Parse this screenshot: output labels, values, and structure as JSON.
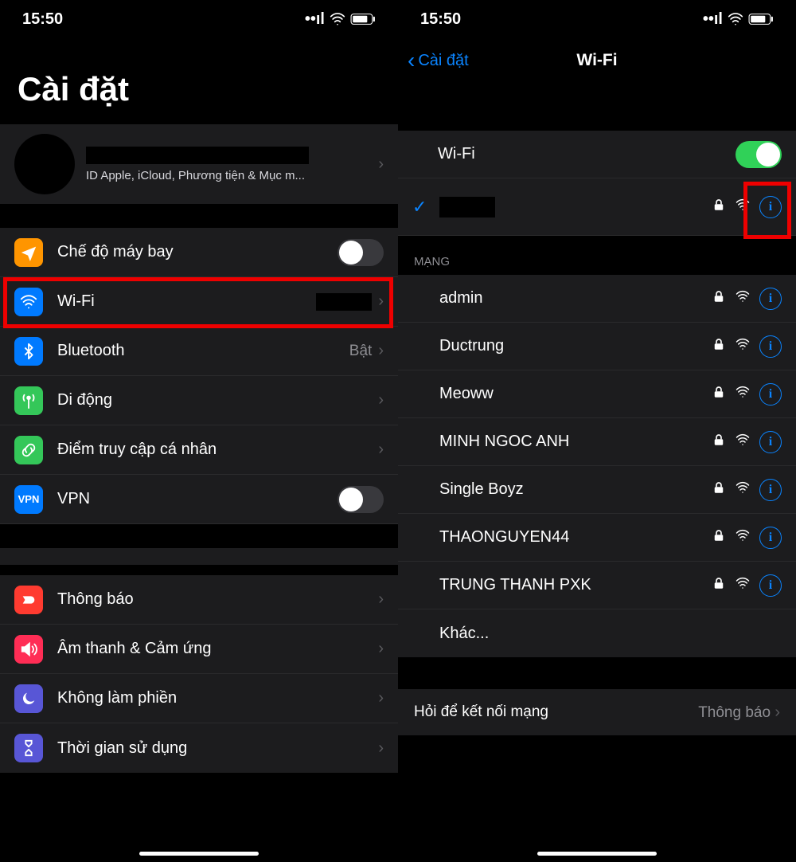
{
  "status": {
    "time": "15:50"
  },
  "left": {
    "title": "Cài đặt",
    "account_sub": "ID Apple, iCloud, Phương tiện & Mục m...",
    "rows": {
      "airplane": "Chế độ máy bay",
      "wifi": "Wi-Fi",
      "bluetooth": "Bluetooth",
      "bluetooth_value": "Bật",
      "cellular": "Di động",
      "hotspot": "Điểm truy cập cá nhân",
      "vpn": "VPN",
      "notifications": "Thông báo",
      "sound": "Âm thanh & Cảm ứng",
      "dnd": "Không làm phiền",
      "screentime": "Thời gian sử dụng"
    }
  },
  "right": {
    "back": "Cài đặt",
    "title": "Wi-Fi",
    "wifi_label": "Wi-Fi",
    "networks_header": "MẠNG",
    "networks": [
      "admin",
      "Ductrung",
      "Meoww",
      "MINH NGOC ANH",
      "Single Boyz",
      "THAONGUYEN44",
      "TRUNG THANH PXK"
    ],
    "other": "Khác...",
    "ask_label": "Hỏi để kết nối mạng",
    "ask_value": "Thông báo"
  },
  "icons": {
    "airplane": "airplane-icon",
    "wifi": "wifi-icon",
    "bluetooth": "bluetooth-icon",
    "cellular": "antenna-icon",
    "hotspot": "link-icon",
    "vpn": "vpn-icon",
    "notifications": "bell-icon",
    "sound": "speaker-icon",
    "dnd": "moon-icon",
    "screentime": "hourglass-icon",
    "lock": "lock-icon",
    "info": "info-icon",
    "signal": "signal-icon",
    "battery": "battery-icon",
    "check": "check-icon",
    "chevron": "chevron-right-icon"
  }
}
